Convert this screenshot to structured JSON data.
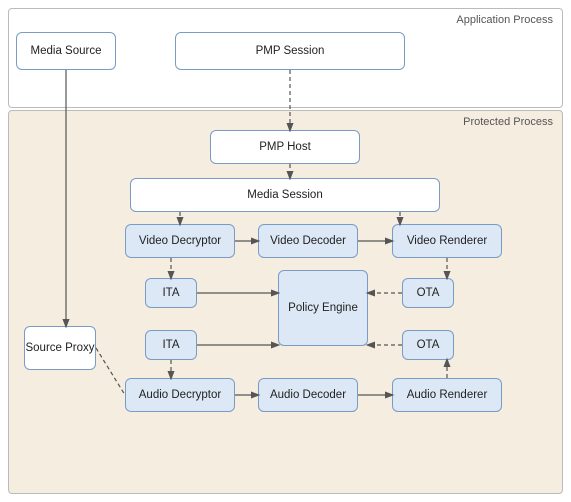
{
  "regions": {
    "app_process": "Application Process",
    "protected_process": "Protected Process"
  },
  "boxes": {
    "media_source": "Media Source",
    "pmp_session": "PMP Session",
    "pmp_host": "PMP Host",
    "media_session": "Media Session",
    "video_decryptor": "Video Decryptor",
    "video_decoder": "Video Decoder",
    "video_renderer": "Video Renderer",
    "ita_top": "ITA",
    "ota_top": "OTA",
    "policy_engine": "Policy\nEngine",
    "ita_bottom": "ITA",
    "ota_bottom": "OTA",
    "audio_decryptor": "Audio Decryptor",
    "audio_decoder": "Audio Decoder",
    "audio_renderer": "Audio Renderer",
    "source_proxy": "Source\nProxy"
  }
}
